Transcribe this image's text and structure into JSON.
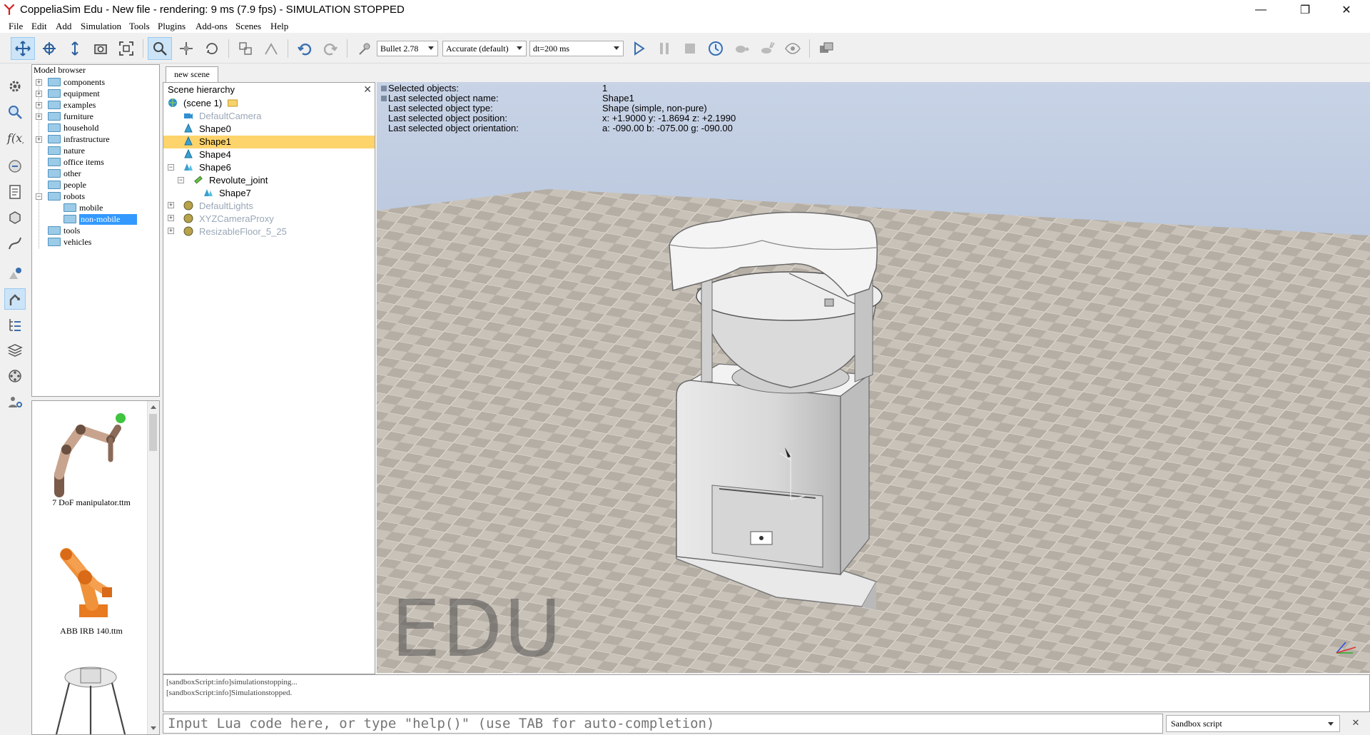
{
  "window": {
    "title": "CoppeliaSim Edu - New file - rendering: 9 ms (7.9 fps) - SIMULATION STOPPED",
    "minimize": "—",
    "restore": "❐",
    "close": "✕"
  },
  "menu": [
    "File",
    "Edit",
    "Add",
    "Simulation",
    "Tools",
    "Plugins",
    "Add-ons",
    "Scenes",
    "Help"
  ],
  "toolbar": {
    "engine": "Bullet 2.78",
    "accuracy": "Accurate (default)",
    "dt": "dt=200 ms"
  },
  "model_browser": {
    "header": "Model browser",
    "items": [
      {
        "label": "components"
      },
      {
        "label": "equipment"
      },
      {
        "label": "examples"
      },
      {
        "label": "furniture"
      },
      {
        "label": "household"
      },
      {
        "label": "infrastructure"
      },
      {
        "label": "nature"
      },
      {
        "label": "office items"
      },
      {
        "label": "other"
      },
      {
        "label": "people"
      },
      {
        "label": "robots"
      },
      {
        "label": "mobile"
      },
      {
        "label": "non-mobile"
      },
      {
        "label": "tools"
      },
      {
        "label": "vehicles"
      }
    ],
    "thumbnails": [
      {
        "label": "7 DoF manipulator.ttm"
      },
      {
        "label": "ABB IRB 140.ttm"
      }
    ]
  },
  "scene_tab": "new scene",
  "hierarchy": {
    "header": "Scene hierarchy",
    "close": "✕",
    "items": [
      {
        "label": "(scene 1)"
      },
      {
        "label": "DefaultCamera"
      },
      {
        "label": "Shape0"
      },
      {
        "label": "Shape1"
      },
      {
        "label": "Shape4"
      },
      {
        "label": "Shape6"
      },
      {
        "label": "Revolute_joint"
      },
      {
        "label": "Shape7"
      },
      {
        "label": "DefaultLights"
      },
      {
        "label": "XYZCameraProxy"
      },
      {
        "label": "ResizableFloor_5_25"
      }
    ]
  },
  "viewport": {
    "info": [
      {
        "key": "Selected objects:",
        "value": "1"
      },
      {
        "key": "Last selected object name:",
        "value": "Shape1"
      },
      {
        "key": "Last selected object type:",
        "value": "Shape (simple, non-pure)"
      },
      {
        "key": "Last selected object position:",
        "value": "x: +1.9000    y: -1.8694    z: +2.1990"
      },
      {
        "key": "Last selected object orientation:",
        "value": "a: -090.00    b: -075.00    g: -090.00"
      }
    ],
    "watermark": "EDU"
  },
  "console": {
    "lines": [
      "[sandboxScript:info]simulationstopping...",
      "[sandboxScript:info]Simulationstopped."
    ]
  },
  "lua_input": {
    "placeholder": "Input Lua code here, or type \"help()\" (use TAB for auto-completion)"
  },
  "script_selector": {
    "value": "Sandbox script"
  },
  "colors": {
    "selection_hierarchy": "#fdd36b",
    "selection_browser": "#3399ff",
    "accent_blue": "#3a7bc8"
  }
}
